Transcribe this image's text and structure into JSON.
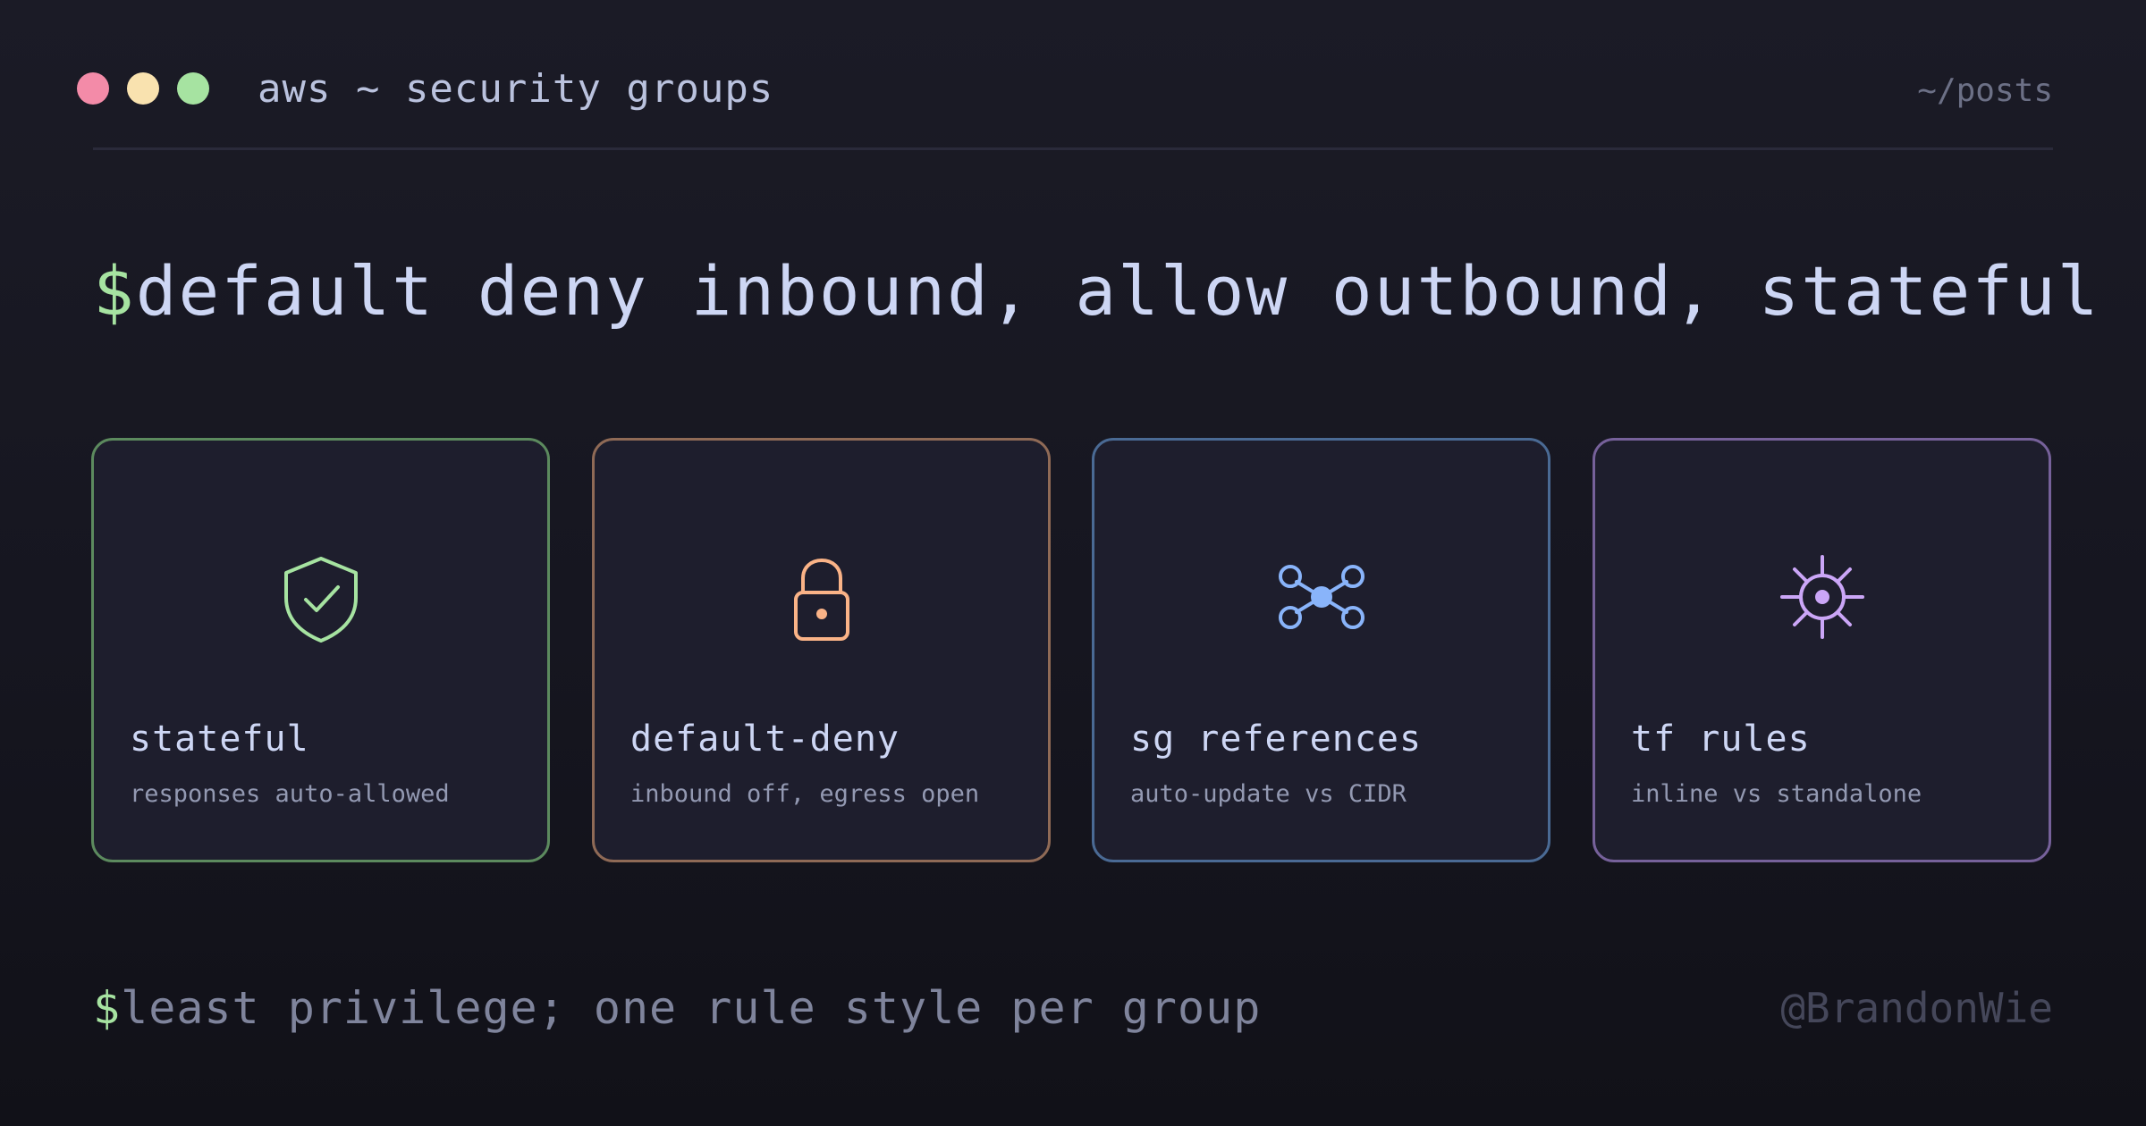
{
  "header": {
    "title": "aws ~ security groups",
    "path": "~/posts",
    "window_dots": [
      {
        "name": "close",
        "color": "#f38ba8"
      },
      {
        "name": "minimize",
        "color": "#f9e2af"
      },
      {
        "name": "maximize",
        "color": "#a6e3a1"
      }
    ]
  },
  "headline": {
    "prompt": "$",
    "text": "default deny inbound, allow outbound, stateful"
  },
  "cards": [
    {
      "title": "stateful",
      "subtitle": "responses auto-allowed",
      "icon": "shield-check-icon",
      "color": "#a6e3a1",
      "border": "#5c8a5e"
    },
    {
      "title": "default-deny",
      "subtitle": "inbound off, egress open",
      "icon": "lock-icon",
      "color": "#fab387",
      "border": "#8f6a56"
    },
    {
      "title": "sg references",
      "subtitle": "auto-update vs CIDR",
      "icon": "network-nodes-icon",
      "color": "#89b4fa",
      "border": "#4a6a94"
    },
    {
      "title": "tf rules",
      "subtitle": "inline vs standalone",
      "icon": "gear-icon",
      "color": "#cba6f7",
      "border": "#76619a"
    }
  ],
  "footer": {
    "prompt": "$",
    "text": "least privilege; one rule style per group",
    "handle": "@BrandonWie"
  },
  "colors": {
    "background": "#181824",
    "card_background": "#1e1e2d",
    "text": "#cdd6f4",
    "prompt": "#a6e3a1"
  }
}
